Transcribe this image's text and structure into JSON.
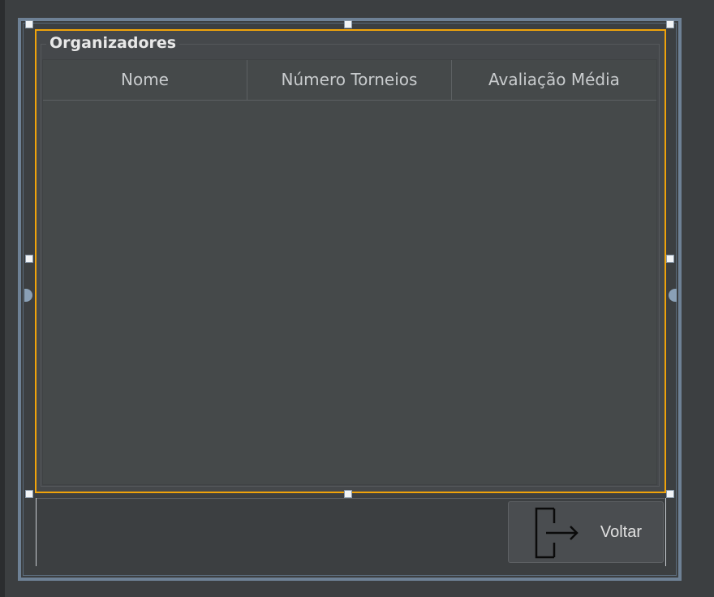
{
  "panel": {
    "title": "Organizadores"
  },
  "table": {
    "columns": [
      "Nome",
      "Número Torneios",
      "Avaliação Média"
    ],
    "rows": []
  },
  "actions": {
    "back_label": "Voltar",
    "back_icon": "exit-icon"
  },
  "colors": {
    "selection": "#f0a30a",
    "form_border": "#6e8195",
    "background": "#3c3f41"
  }
}
